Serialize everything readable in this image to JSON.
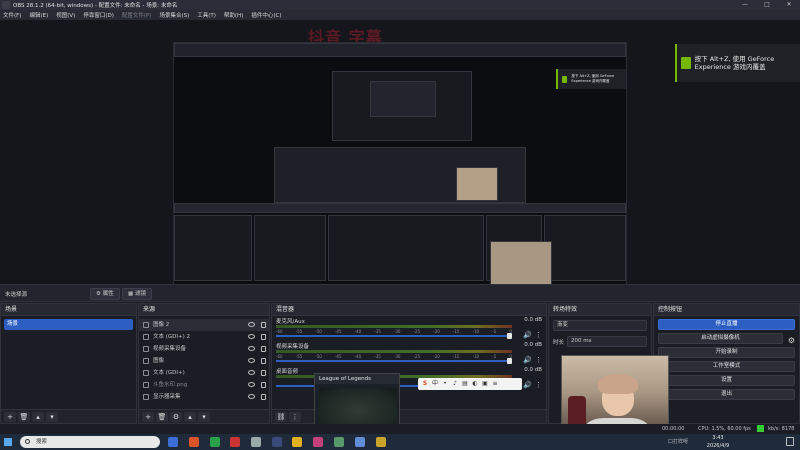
{
  "window": {
    "title": "OBS 28.1.2 (64-bit, windows) - 配置文件: 未命名 - 场景: 未命名",
    "controls": [
      "—",
      "□",
      "✕"
    ]
  },
  "menu": {
    "items": [
      "文件(F)",
      "编辑(E)",
      "视图(V)",
      "停靠窗口(D)",
      "配置文件(P)",
      "场景集合(S)",
      "工具(T)",
      "帮助(H)",
      "插件中心(C)"
    ]
  },
  "overlay": {
    "watermark": "抖音 字幕",
    "geforce_text": "按下 Alt+Z, 使用 GeForce Experience 游戏内覆盖",
    "geforce_text_small": "按下 Alt+Z, 使用 GeForce Experience 游戏内覆盖"
  },
  "toolbar": {
    "no_scene": "未选择源",
    "properties": "属性",
    "filters": "滤镜"
  },
  "scenes": {
    "header": "场景",
    "items": [
      "场景"
    ]
  },
  "sources": {
    "header": "来源",
    "items": [
      {
        "name": "图像 2"
      },
      {
        "name": "文本 (GDI+) 2"
      },
      {
        "name": "视频采集设备"
      },
      {
        "name": "图像"
      },
      {
        "name": "文本 (GDI+)"
      },
      {
        "name": "斗鱼水印.png"
      },
      {
        "name": "显示器采集"
      }
    ]
  },
  "mixer": {
    "header": "混音器",
    "tracks": [
      {
        "name": "麦克风/Aux",
        "db": "0.0 dB"
      },
      {
        "name": "视频采集设备",
        "db": "0.0 dB"
      },
      {
        "name": "桌面音频",
        "db": "0.0 dB"
      }
    ],
    "scale": [
      "-60",
      "-55",
      "-50",
      "-45",
      "-40",
      "-35",
      "-30",
      "-25",
      "-20",
      "-15",
      "-10",
      "-5",
      "0"
    ]
  },
  "transitions": {
    "header": "转场特效",
    "type": "渐变",
    "duration_label": "时长",
    "duration": "200 ms"
  },
  "controls": {
    "header": "控制按钮",
    "buttons": [
      "停止直播",
      "启动虚拟摄像机",
      "开始录制",
      "工作室模式",
      "设置",
      "退出"
    ]
  },
  "lol_window": {
    "title": "League of Legends"
  },
  "status": {
    "time": "00:00:00",
    "cpu": "CPU: 1.5%, 60.00 fps",
    "kbps": "kb/s: 8178",
    "hidden": "口打样呀"
  },
  "taskbar": {
    "search": "搜索",
    "clock_time": "3:43",
    "clock_date": "2026/4/9"
  },
  "colors": {
    "accent": "#2d5ec2",
    "geforce": "#76b900",
    "watermark": "#b21e2d",
    "live": "#33cc33"
  }
}
